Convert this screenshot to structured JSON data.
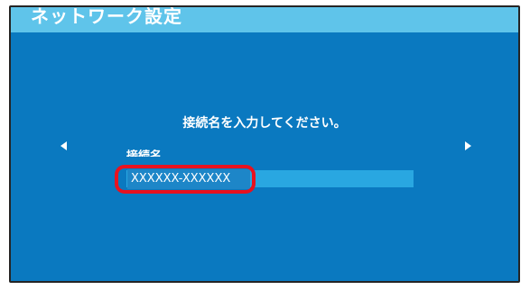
{
  "header": {
    "title": "ネットワーク設定"
  },
  "main": {
    "prompt": "接続名を入力してください。",
    "field": {
      "label": "接続名",
      "value": "XXXXXX-XXXXXX"
    }
  },
  "colors": {
    "screen_background": "#0a79c0",
    "title_bar": "#5fc4ea",
    "input_bar": "#29a7e1",
    "highlight": "#e8121f"
  },
  "icons": {
    "left": "triangle-left-icon",
    "right": "triangle-right-icon"
  }
}
